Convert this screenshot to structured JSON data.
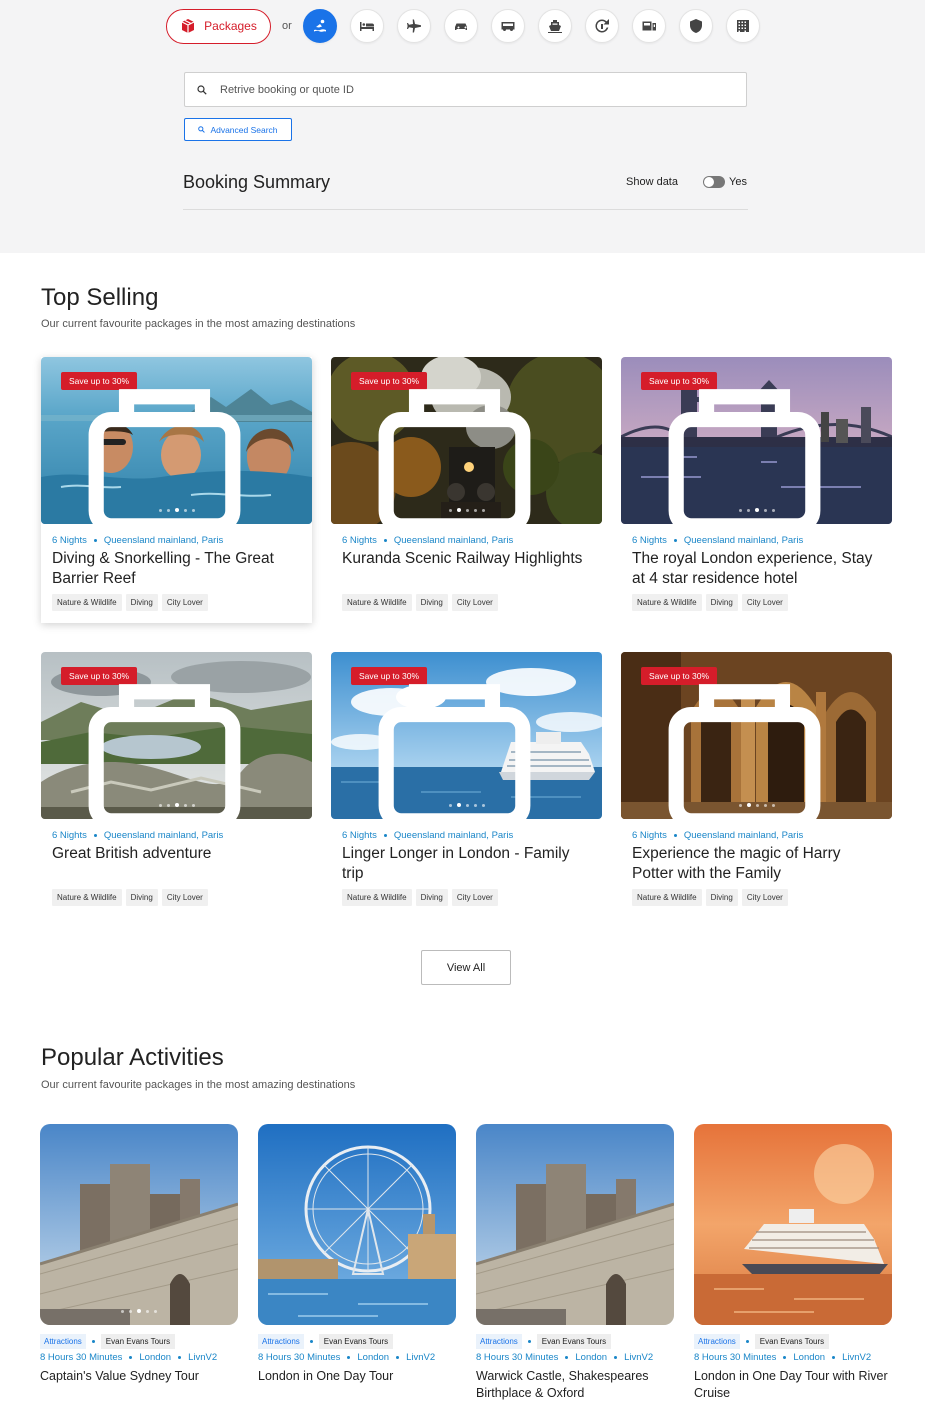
{
  "header": {
    "packages_label": "Packages",
    "or_label": "or",
    "categories": [
      {
        "icon": "activities-icon",
        "active": true
      },
      {
        "icon": "hotel-icon"
      },
      {
        "icon": "flight-icon"
      },
      {
        "icon": "car-icon"
      },
      {
        "icon": "bus-icon"
      },
      {
        "icon": "cruise-icon"
      },
      {
        "icon": "transfer-icon"
      },
      {
        "icon": "rail-icon"
      },
      {
        "icon": "insurance-icon"
      },
      {
        "icon": "other-icon"
      }
    ]
  },
  "search": {
    "placeholder": "Retrive booking or quote ID",
    "advanced_label": "Advanced Search"
  },
  "booking": {
    "title": "Booking Summary",
    "show_data_label": "Show data",
    "toggle_label": "Yes"
  },
  "top_selling": {
    "title": "Top Selling",
    "subtitle": "Our current favourite packages in the most amazing destinations",
    "cards": [
      {
        "badge": "Save up to 30%",
        "nights": "6 Nights",
        "location": "Queensland mainland, Paris",
        "name": "Diving & Snorkelling - The Great Barrier Reef",
        "tags": [
          "Nature & Wildlife",
          "Diving",
          "City Lover"
        ]
      },
      {
        "badge": "Save up to 30%",
        "nights": "6 Nights",
        "location": "Queensland mainland, Paris",
        "name": "Kuranda Scenic Railway Highlights",
        "tags": [
          "Nature & Wildlife",
          "Diving",
          "City Lover"
        ]
      },
      {
        "badge": "Save up to 30%",
        "nights": "6 Nights",
        "location": "Queensland mainland, Paris",
        "name": "The royal London experience, Stay at 4 star residence hotel",
        "tags": [
          "Nature & Wildlife",
          "Diving",
          "City Lover"
        ]
      },
      {
        "badge": "Save up to 30%",
        "nights": "6 Nights",
        "location": "Queensland mainland, Paris",
        "name": "Great British adventure",
        "tags": [
          "Nature & Wildlife",
          "Diving",
          "City Lover"
        ]
      },
      {
        "badge": "Save up to 30%",
        "nights": "6 Nights",
        "location": "Queensland mainland, Paris",
        "name": "Linger Longer in London - Family trip",
        "tags": [
          "Nature & Wildlife",
          "Diving",
          "City Lover"
        ]
      },
      {
        "badge": "Save up to 30%",
        "nights": "6 Nights",
        "location": "Queensland mainland, Paris",
        "name": "Experience the magic of Harry Potter with the Family",
        "tags": [
          "Nature & Wildlife",
          "Diving",
          "City Lover"
        ]
      }
    ],
    "view_all_label": "View All"
  },
  "popular": {
    "title": "Popular Activities",
    "subtitle": "Our current favourite packages in the most amazing destinations",
    "cards": [
      {
        "category": "Attractions",
        "operator": "Evan Evans Tours",
        "duration": "8 Hours 30 Minutes",
        "city": "London",
        "source": "LivnV2",
        "name": "Captain's Value Sydney Tour"
      },
      {
        "category": "Attractions",
        "operator": "Evan Evans Tours",
        "duration": "8 Hours 30 Minutes",
        "city": "London",
        "source": "LivnV2",
        "name": "London in One Day Tour"
      },
      {
        "category": "Attractions",
        "operator": "Evan Evans Tours",
        "duration": "8 Hours 30 Minutes",
        "city": "London",
        "source": "LivnV2",
        "name": "Warwick Castle, Shakespeares Birthplace & Oxford"
      },
      {
        "category": "Attractions",
        "operator": "Evan Evans Tours",
        "duration": "8 Hours 30 Minutes",
        "city": "London",
        "source": "LivnV2",
        "name": "London in One Day Tour with River Cruise"
      }
    ]
  },
  "colors": {
    "brand_red": "#d51d2a",
    "accent_blue": "#1a73e8",
    "meta_blue": "#1a86c8"
  }
}
